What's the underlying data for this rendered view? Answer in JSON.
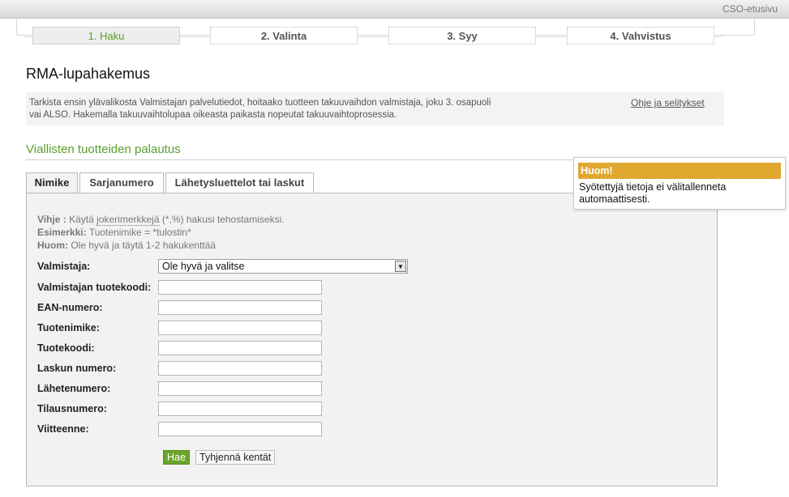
{
  "header": {
    "home_link": "CSO-etusivu"
  },
  "steps": [
    "1. Haku",
    "2. Valinta",
    "3. Syy",
    "4. Vahvistus"
  ],
  "page_title": "RMA-lupahakemus",
  "info": {
    "text": "Tarkista ensin ylävalikosta Valmistajan palvelutiedot, hoitaako tuotteen takuuvaihdon valmistaja, joku 3. osapuoli vai ALSO. Hakemalla takuuvaihtolupaa oikeasta paikasta nopeutat takuuvaihtoprosessia.",
    "help_link": "Ohje ja selitykset"
  },
  "section_title": "Viallisten tuotteiden palautus",
  "tabs": [
    "Nimike",
    "Sarjanumero",
    "Lähetysluettelot tai laskut"
  ],
  "hint": {
    "vihje_label": "Vihje :",
    "vihje_pre": " Käytä ",
    "vihje_link": "jokerimerkkejä",
    "vihje_post": " (*,%) hakusi tehostamiseksi.",
    "esimerkki_label": "Esimerkki:",
    "esimerkki_text": " Tuotenimike = *tulostin*",
    "huom_label": "Huom:",
    "huom_text": " Ole hyvä ja täytä 1-2 hakukenttää"
  },
  "form": {
    "manufacturer_label": "Valmistaja:",
    "manufacturer_selected": "Ole hyvä ja valitse",
    "fields": [
      {
        "label": "Valmistajan tuotekoodi:",
        "value": ""
      },
      {
        "label": "EAN-numero:",
        "value": ""
      },
      {
        "label": "Tuotenimike:",
        "value": ""
      },
      {
        "label": "Tuotekoodi:",
        "value": ""
      },
      {
        "label": "Laskun numero:",
        "value": ""
      },
      {
        "label": "Lähetenumero:",
        "value": ""
      },
      {
        "label": "Tilausnumero:",
        "value": ""
      },
      {
        "label": "Viitteenne:",
        "value": ""
      }
    ],
    "search_button": "Hae",
    "clear_button": "Tyhjennä kentät"
  },
  "notice": {
    "title": "Huom!",
    "text": "Syötettyjä tietoja ei välitallenneta automaattisesti."
  },
  "colors": {
    "accent_green": "#5a9e29",
    "notice_orange": "#e0a72f"
  }
}
